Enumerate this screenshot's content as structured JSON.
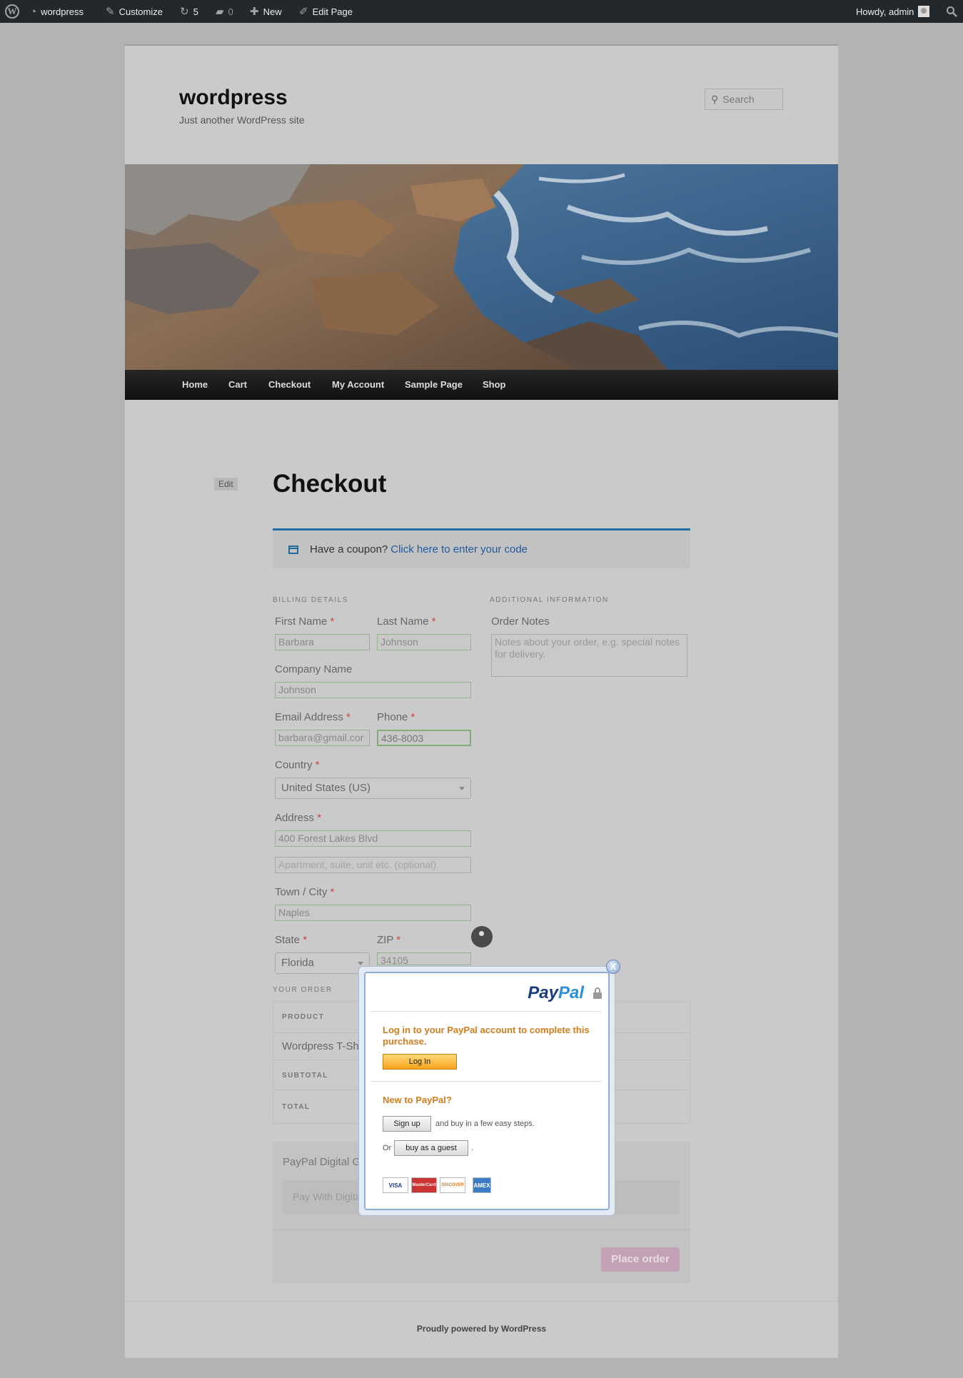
{
  "admin_bar": {
    "site_name": "wordpress",
    "customize": "Customize",
    "updates_count": "5",
    "comments_count": "0",
    "new_label": "New",
    "edit_page": "Edit Page",
    "greeting": "Howdy, admin"
  },
  "site": {
    "title": "wordpress",
    "tagline": "Just another WordPress site",
    "search_placeholder": "Search"
  },
  "nav": {
    "items": [
      "Home",
      "Cart",
      "Checkout",
      "My Account",
      "Sample Page",
      "Shop"
    ]
  },
  "page": {
    "edit_label": "Edit",
    "title": "Checkout"
  },
  "coupon": {
    "text": "Have a coupon?",
    "link": "Click here to enter your code"
  },
  "billing": {
    "heading": "BILLING DETAILS",
    "first_name_label": "First Name",
    "first_name": "Barbara",
    "last_name_label": "Last Name",
    "last_name": "Johnson",
    "company_label": "Company Name",
    "company": "Johnson",
    "email_label": "Email Address",
    "email": "barbara@gmail.cor",
    "phone_label": "Phone",
    "phone": "436-8003",
    "country_label": "Country",
    "country": "United States (US)",
    "address_label": "Address",
    "address1": "400 Forest Lakes Blvd",
    "address2_placeholder": "Apartment, suite, unit etc. (optional)",
    "city_label": "Town / City",
    "city": "Naples",
    "state_label": "State",
    "state": "Florida",
    "zip_label": "ZIP",
    "zip": "34105",
    "required_mark": "*"
  },
  "additional": {
    "heading": "ADDITIONAL INFORMATION",
    "notes_label": "Order Notes",
    "notes_placeholder": "Notes about your order, e.g. special notes for delivery."
  },
  "order": {
    "heading": "YOUR ORDER",
    "product_header": "PRODUCT",
    "product_name": "Wordpress T-Sh",
    "subtotal_label": "SUBTOTAL",
    "total_label": "TOTAL"
  },
  "payment": {
    "method": "PayPal Digital G",
    "description": "Pay With Digita",
    "place_order": "Place order"
  },
  "footer": {
    "text": "Proudly powered by WordPress"
  },
  "paypal_modal": {
    "close": "X",
    "logo_pay": "Pay",
    "logo_pal": "Pal",
    "login_heading": "Log in to your PayPal account to complete this purchase.",
    "login_button": "Log In",
    "new_heading": "New to PayPal?",
    "signup_button": "Sign up",
    "signup_text": "and buy in a few easy steps.",
    "or_text": "Or",
    "guest_button": "buy as a guest",
    "period": ".",
    "cards": [
      "VISA",
      "MasterCard",
      "DISCOVER",
      "AMEX"
    ]
  },
  "colors": {
    "admin_bar_bg": "#23282d",
    "coupon_border": "#1e6e9e",
    "link": "#1e5a9e",
    "paypal_orange": "#d17d1d",
    "place_order_bg": "#c3a2b6"
  }
}
